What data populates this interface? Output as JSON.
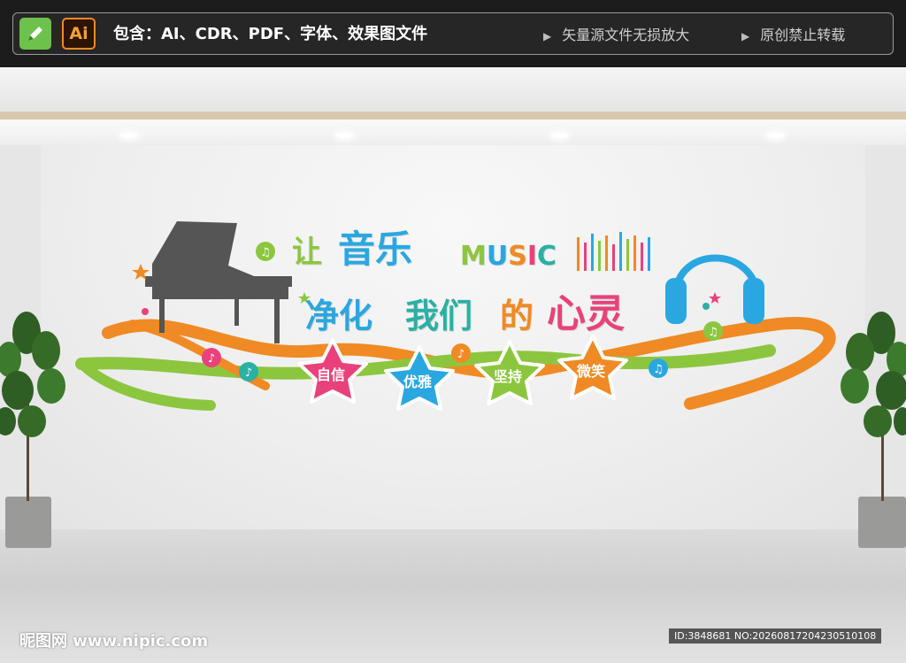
{
  "banner": {
    "contains_text": "包含：AI、CDR、PDF、字体、效果图文件",
    "feature_1": "矢量源文件无损放大",
    "feature_2": "原创禁止转载",
    "ai_label": "Ai",
    "icons": [
      "edit-icon",
      "adobe-illustrator-icon",
      "triangle-right-icon"
    ]
  },
  "wall": {
    "title_rang": "让",
    "title_yinyue": "音乐",
    "title_music": [
      "M",
      "U",
      "S",
      "I",
      "C"
    ],
    "subtitle_jinghua": "净化",
    "subtitle_women": "我们",
    "subtitle_de": "的",
    "subtitle_xinling": "心灵",
    "badges": [
      "自信",
      "优雅",
      "坚持",
      "微笑"
    ],
    "music_letter_colors": [
      "#8cc63f",
      "#2aa7e0",
      "#f08a24",
      "#e9417b",
      "#2bb0a4"
    ],
    "badge_colors": [
      "#e9417b",
      "#2aa7e0",
      "#8cc63f",
      "#f08a24"
    ],
    "icons": [
      "piano-icon",
      "headphones-icon",
      "equalizer-icon",
      "music-note-icon",
      "star-icon",
      "ribbon-wave",
      "potted-plant"
    ]
  },
  "watermark": {
    "site": "昵图网 www.nipic.com",
    "id": "ID:3848681 NO:20260817204230510108"
  }
}
